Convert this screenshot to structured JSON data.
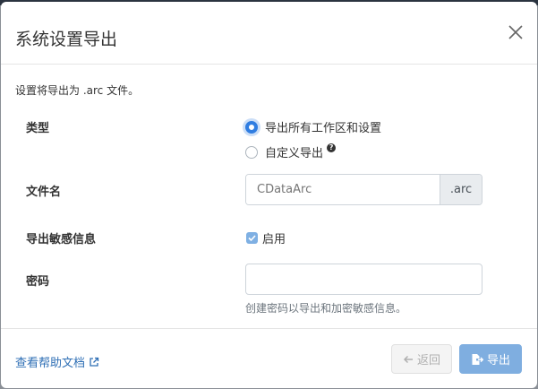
{
  "dialog": {
    "title": "系统设置导出",
    "intro": "设置将导出为 .arc 文件。"
  },
  "type_row": {
    "label": "类型",
    "options": [
      {
        "label": "导出所有工作区和设置",
        "checked": true
      },
      {
        "label": "自定义导出",
        "checked": false
      }
    ],
    "help_icon": "?"
  },
  "filename_row": {
    "label": "文件名",
    "placeholder": "CDataArc",
    "value": "",
    "extension": ".arc"
  },
  "sensitive_row": {
    "label": "导出敏感信息",
    "checkbox_label": "启用",
    "checked": true
  },
  "password_row": {
    "label": "密码",
    "value": "",
    "hint": "创建密码以导出和加密敏感信息。"
  },
  "footer": {
    "help_link": "查看帮助文档",
    "back_label": "返回",
    "export_label": "导出"
  },
  "colors": {
    "accent": "#2f7de1",
    "export_button": "#7faee0",
    "link": "#2f6fb5"
  },
  "icons": {
    "close": "close-icon",
    "help": "question-circle-icon",
    "external": "external-link-icon",
    "back": "arrow-left-icon",
    "export": "file-export-icon",
    "check": "check-icon"
  }
}
